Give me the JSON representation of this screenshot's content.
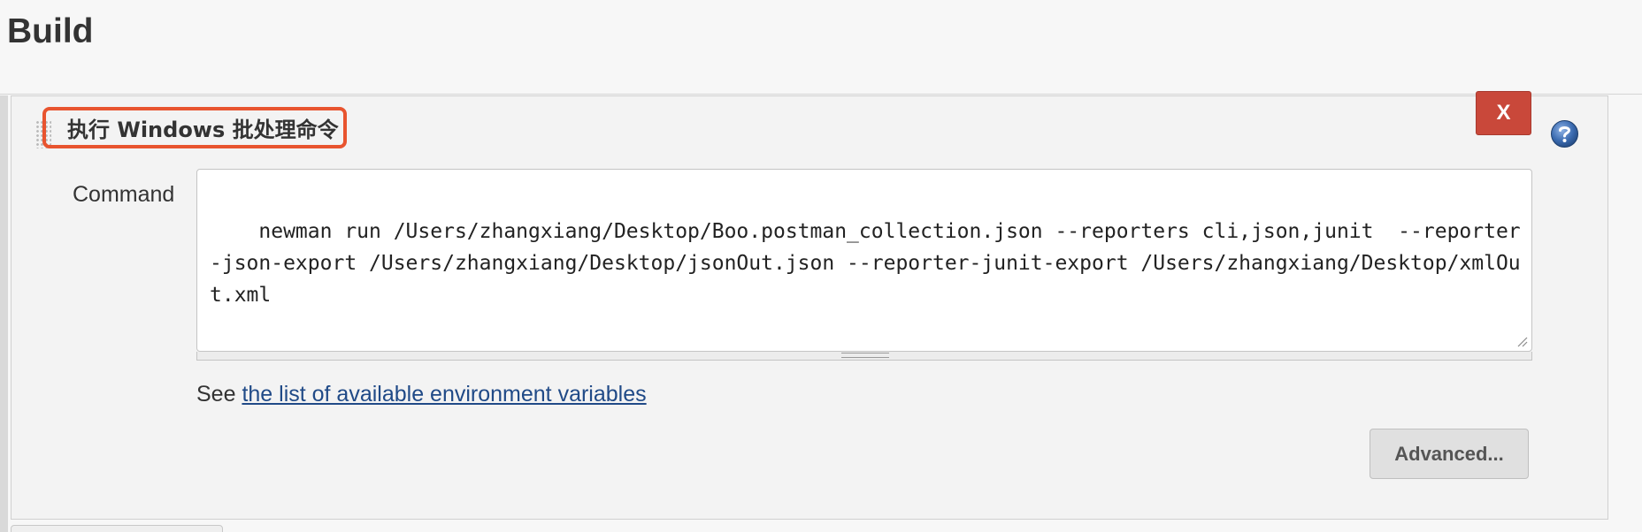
{
  "section": {
    "title": "Build"
  },
  "step": {
    "title": "执行 Windows 批处理命令",
    "delete_label": "X",
    "help_icon": "question-mark-icon",
    "command_label": "Command",
    "command_value": "newman run /Users/zhangxiang/Desktop/Boo.postman_collection.json --reporters cli,json,junit  --reporter-json-export /Users/zhangxiang/Desktop/jsonOut.json --reporter-junit-export /Users/zhangxiang/Desktop/xmlOut.xml",
    "hint_prefix": "See ",
    "hint_link": "the list of available environment variables",
    "advanced_label": "Advanced..."
  },
  "colors": {
    "delete_button": "#c9483a",
    "annotation_outline": "#e8542f",
    "link": "#204a87",
    "help_icon": "#3b6bb0"
  }
}
